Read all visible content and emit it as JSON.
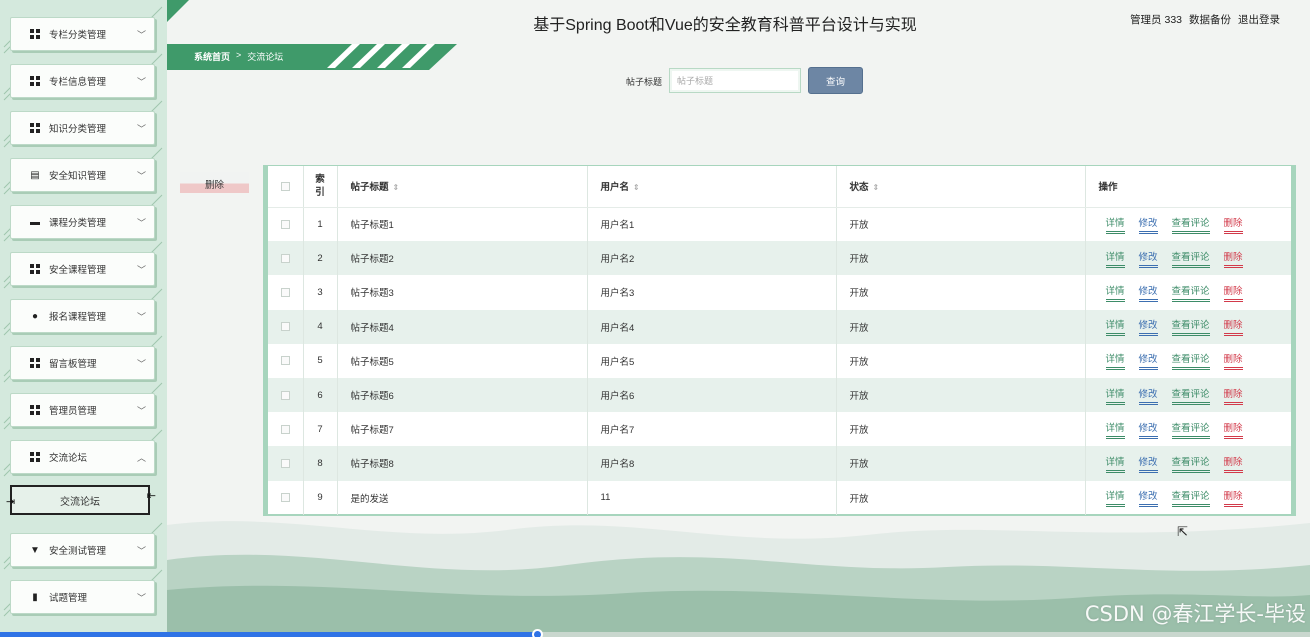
{
  "app": {
    "title": "基于Spring Boot和Vue的安全教育科普平台设计与实现"
  },
  "header": {
    "user_label": "管理员 333",
    "backup_label": "数据备份",
    "logout_label": "退出登录"
  },
  "breadcrumb": {
    "home": "系统首页",
    "separator": ">",
    "current": "交流论坛"
  },
  "sidebar": {
    "items": [
      {
        "label": "专栏分类管理",
        "icon": "grid-icon",
        "expanded": false
      },
      {
        "label": "专栏信息管理",
        "icon": "grid-icon",
        "expanded": false
      },
      {
        "label": "知识分类管理",
        "icon": "grid-icon",
        "expanded": false
      },
      {
        "label": "安全知识管理",
        "icon": "document-icon",
        "expanded": false
      },
      {
        "label": "课程分类管理",
        "icon": "monitor-icon",
        "expanded": false
      },
      {
        "label": "安全课程管理",
        "icon": "grid-icon",
        "expanded": false
      },
      {
        "label": "报名课程管理",
        "icon": "user-icon",
        "expanded": false
      },
      {
        "label": "留言板管理",
        "icon": "grid-icon",
        "expanded": false
      },
      {
        "label": "管理员管理",
        "icon": "grid-icon",
        "expanded": false
      },
      {
        "label": "交流论坛",
        "icon": "grid-icon",
        "expanded": true
      },
      {
        "label": "安全测试管理",
        "icon": "pen-icon",
        "expanded": false
      },
      {
        "label": "试题管理",
        "icon": "book-icon",
        "expanded": false
      }
    ],
    "sub_item": "交流论坛"
  },
  "search": {
    "label": "帖子标题",
    "placeholder": "帖子标题",
    "value": "",
    "button": "查询"
  },
  "actions": {
    "delete": "删除"
  },
  "table": {
    "headers": {
      "index": "索引",
      "title": "帖子标题",
      "username": "用户名",
      "status": "状态",
      "ops": "操作"
    },
    "op_labels": {
      "detail": "详情",
      "edit": "修改",
      "comments": "查看评论",
      "delete": "删除"
    },
    "rows": [
      {
        "index": "1",
        "title": "帖子标题1",
        "username": "用户名1",
        "status": "开放"
      },
      {
        "index": "2",
        "title": "帖子标题2",
        "username": "用户名2",
        "status": "开放"
      },
      {
        "index": "3",
        "title": "帖子标题3",
        "username": "用户名3",
        "status": "开放"
      },
      {
        "index": "4",
        "title": "帖子标题4",
        "username": "用户名4",
        "status": "开放"
      },
      {
        "index": "5",
        "title": "帖子标题5",
        "username": "用户名5",
        "status": "开放"
      },
      {
        "index": "6",
        "title": "帖子标题6",
        "username": "用户名6",
        "status": "开放"
      },
      {
        "index": "7",
        "title": "帖子标题7",
        "username": "用户名7",
        "status": "开放"
      },
      {
        "index": "8",
        "title": "帖子标题8",
        "username": "用户名8",
        "status": "开放"
      },
      {
        "index": "9",
        "title": "是的发送",
        "username": "11",
        "status": "开放"
      }
    ]
  },
  "watermark": "CSDN @春江学长-毕设",
  "video_progress": 0.41,
  "colors": {
    "accent_green": "#3d8c68",
    "edit_blue": "#3c6fb0",
    "delete_red": "#d23a4a",
    "search_button": "#6d86a4",
    "sidebar_bg": "#d4e9dd"
  }
}
